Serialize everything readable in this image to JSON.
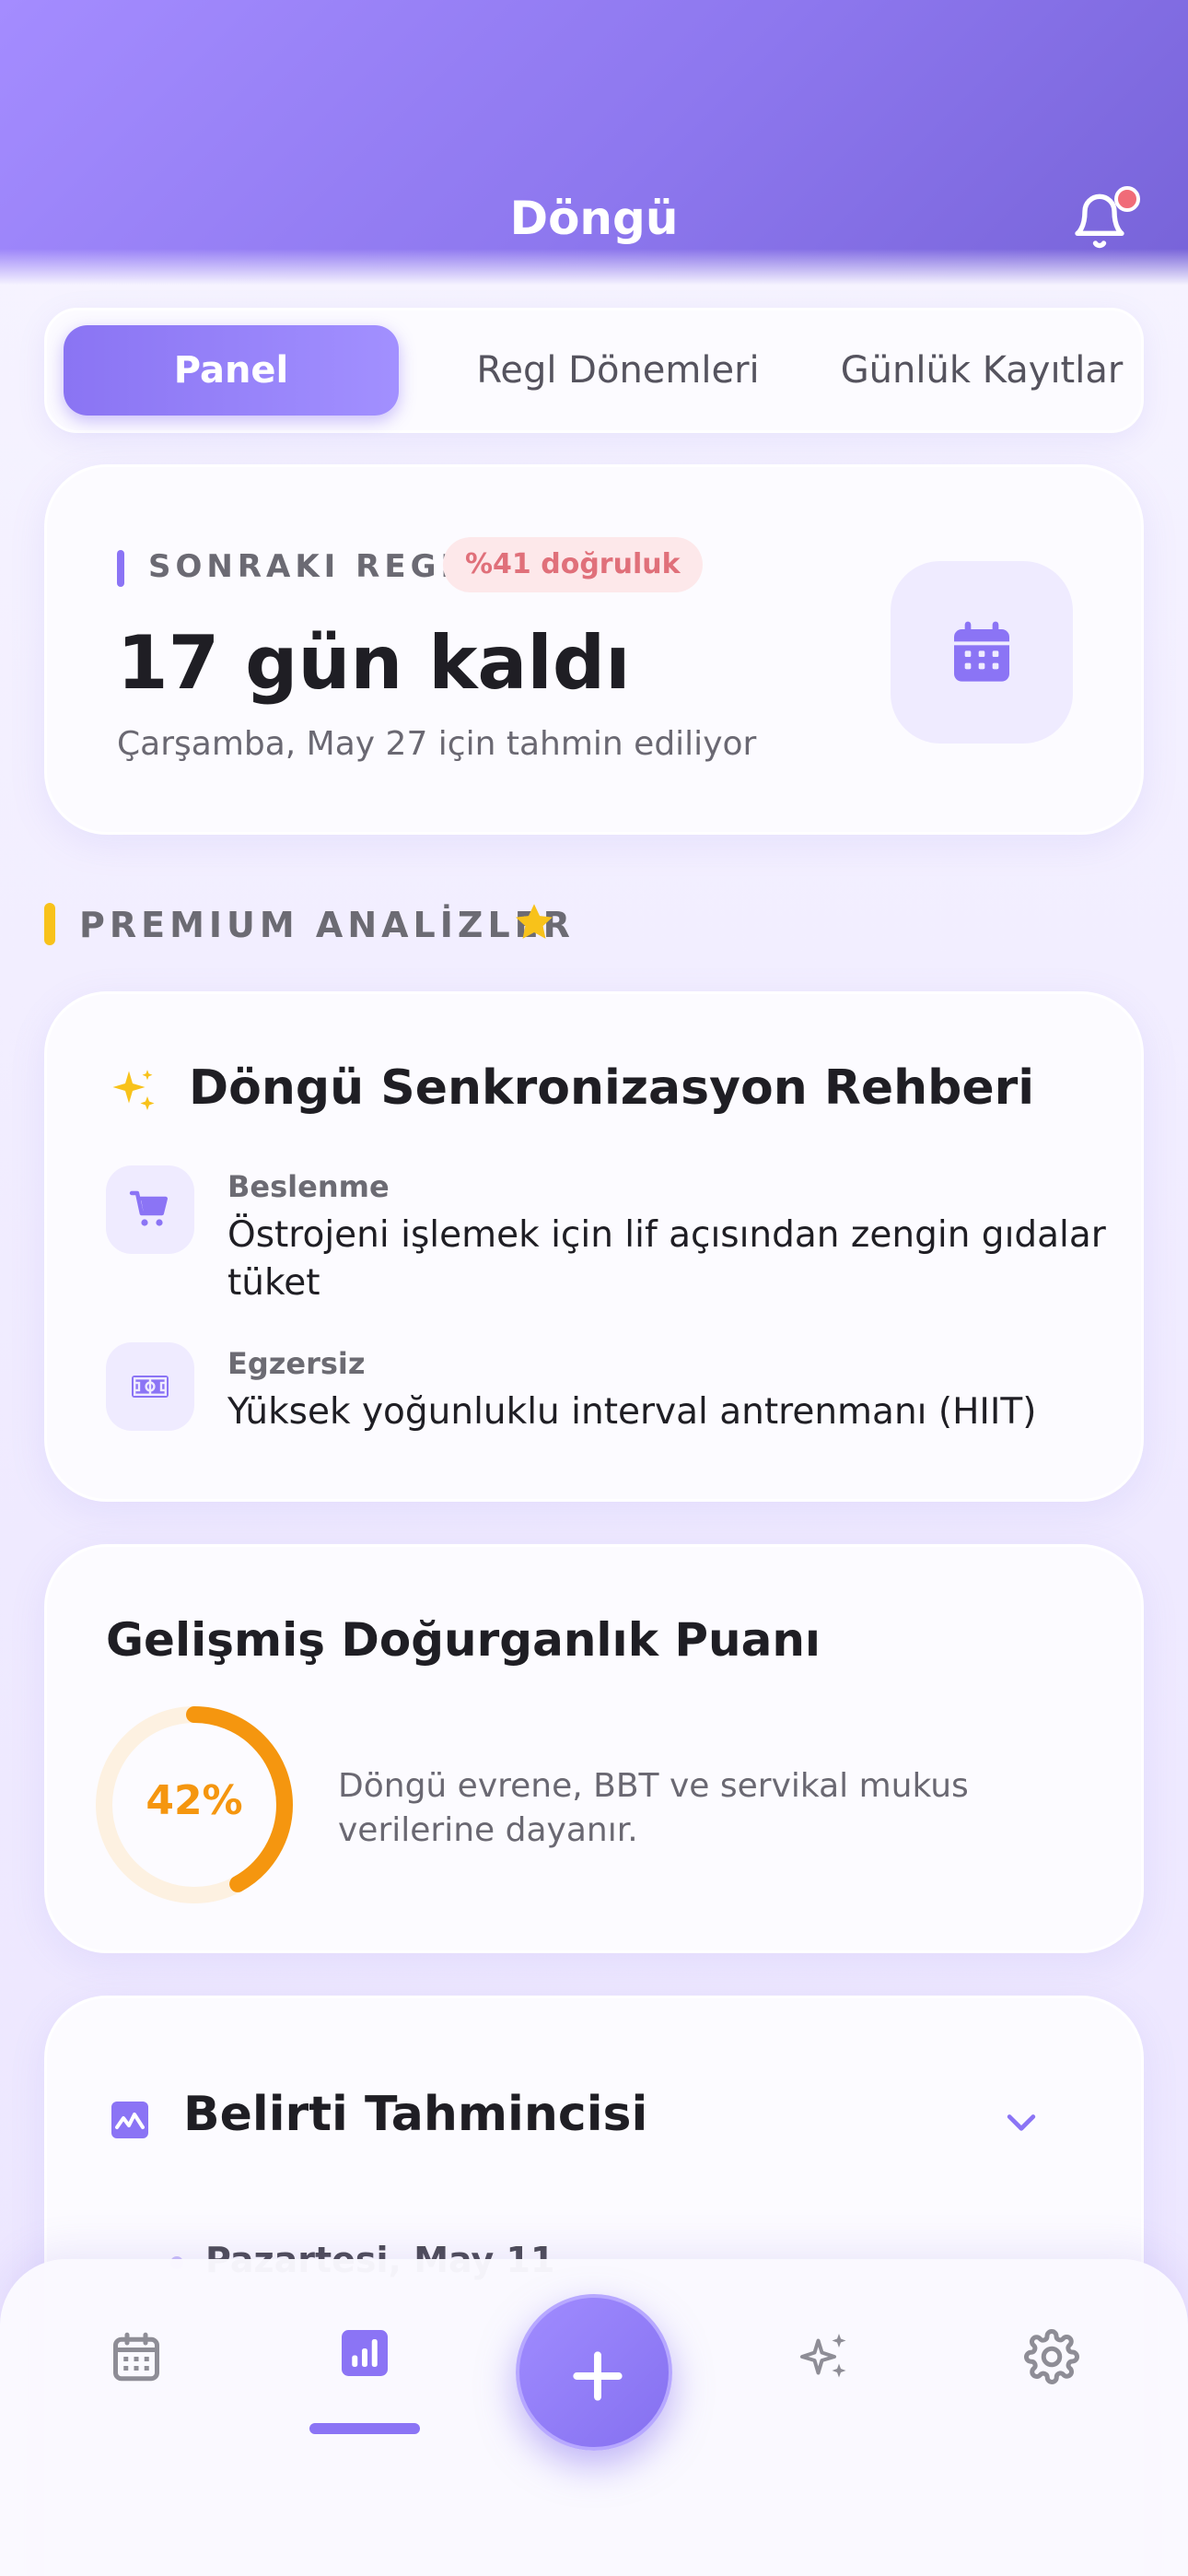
{
  "header": {
    "title": "Döngü"
  },
  "tabs": [
    {
      "label": "Panel",
      "active": true
    },
    {
      "label": "Regl Dönemleri",
      "active": false
    },
    {
      "label": "Günlük Kayıtlar",
      "active": false
    }
  ],
  "next_period": {
    "label": "SONRAKI REGL",
    "accuracy": "%41 doğruluk",
    "days_left": "17 gün kaldı",
    "prediction": "Çarşamba, May 27 için tahmin ediliyor",
    "icon": "calendar-icon"
  },
  "premium": {
    "title": "PREMIUM ANALİZLER",
    "icon": "star-icon",
    "color": "#f8c21a"
  },
  "sync_guide": {
    "title": "Döngü Senkronizasyon Rehberi",
    "items": [
      {
        "label": "Beslenme",
        "text": "Östrojeni işlemek için lif açısından zengin gıdalar tüket",
        "icon": "cart-icon"
      },
      {
        "label": "Egzersiz",
        "text": "Yüksek yoğunluklu interval antrenmanı (HIIT)",
        "icon": "stadium-icon"
      }
    ]
  },
  "fertility": {
    "title": "Gelişmiş Doğurganlık Puanı",
    "score_text": "42%",
    "score": 0.42,
    "description": "Döngü evrene, BBT ve servikal mukus verilerine dayanır.",
    "color": "#f5960f"
  },
  "symptom_predictor": {
    "title": "Belirti Tahmincisi",
    "first_day": "Pazartesi, May 11"
  },
  "bottom_nav": {
    "items": [
      "calendar-icon",
      "chart-icon",
      "add-icon",
      "sparkles-icon",
      "gear-icon"
    ],
    "active": "chart-icon"
  },
  "colors": {
    "accent": "#8b74f5",
    "warning": "#f5960f",
    "danger": "#f06b78"
  }
}
